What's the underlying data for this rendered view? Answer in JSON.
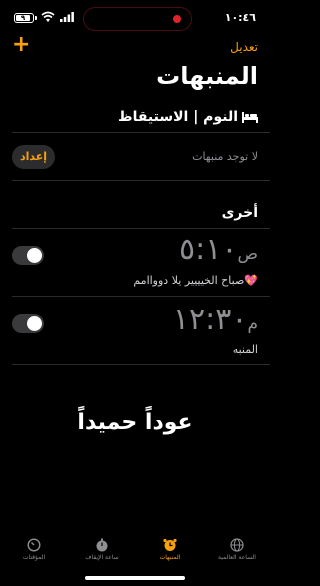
{
  "status_bar": {
    "time": "١٠:٤٦",
    "battery_level": "٩"
  },
  "header": {
    "edit": "تعديل",
    "add": "+",
    "title": "المنبهات"
  },
  "sleep": {
    "title": "النوم | الاستيقاظ",
    "no_alarms": "لا توجد منبهات",
    "setup_button": "إعداد"
  },
  "other": {
    "title": "أخرى"
  },
  "alarms": [
    {
      "time": "٥:١٠",
      "ampm": "ص",
      "label": "صباح الخيييير يلا دوواامم💖",
      "enabled": true
    },
    {
      "time": "١٢:٣٠",
      "ampm": "م",
      "label": "المنبه",
      "enabled": true
    }
  ],
  "overlay_text": "عوداً حميداً",
  "tabs": [
    {
      "label": "الساعة العالمية",
      "icon": "globe-icon"
    },
    {
      "label": "المنبهات",
      "icon": "alarm-clock-icon",
      "active": true
    },
    {
      "label": "ساعة الإيقاف",
      "icon": "stopwatch-icon"
    },
    {
      "label": "المؤقتات",
      "icon": "timer-icon"
    }
  ],
  "colors": {
    "accent": "#f7a10c",
    "background": "#000000",
    "muted": "#8e8e93"
  }
}
